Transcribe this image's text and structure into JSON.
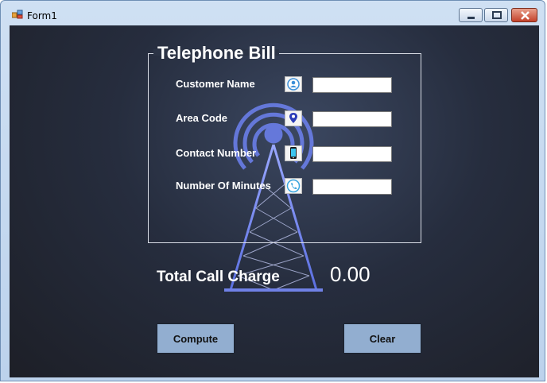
{
  "window": {
    "title": "Form1",
    "controls": {
      "minimize": "minimize",
      "maximize": "maximize",
      "close": "close"
    }
  },
  "form": {
    "group_title": "Telephone Bill",
    "fields": [
      {
        "label": "Customer Name",
        "icon": "user-icon",
        "value": ""
      },
      {
        "label": "Area Code",
        "icon": "location-pin-icon",
        "value": ""
      },
      {
        "label": "Contact Number",
        "icon": "mobile-phone-icon",
        "value": ""
      },
      {
        "label": "Number Of Minutes",
        "icon": "phone-call-icon",
        "value": ""
      }
    ]
  },
  "total": {
    "label": "Total Call Charge",
    "value": "0.00"
  },
  "buttons": {
    "compute": "Compute",
    "clear": "Clear"
  },
  "colors": {
    "button_bg": "#92aed0",
    "tower": "#6a7ee8"
  }
}
